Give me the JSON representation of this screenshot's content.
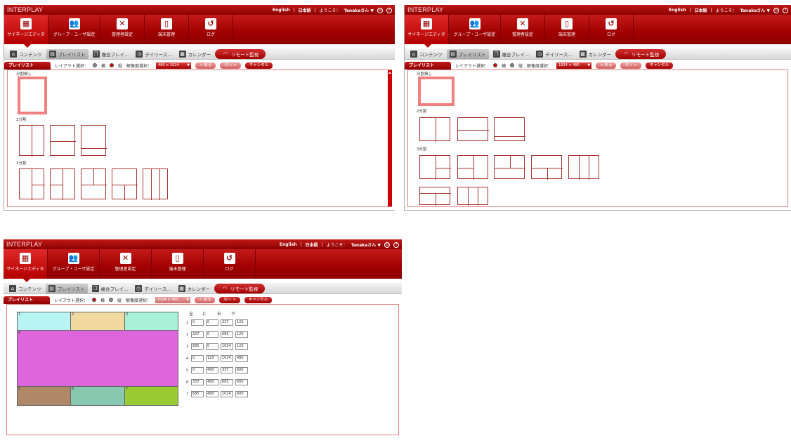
{
  "app": {
    "logo": "INTERPLAY",
    "lang_en": "English",
    "lang_ja": "日本語",
    "welcome": "ようこそ：",
    "user": "Tanakaさん ▼",
    "power_glyph": "⏻",
    "help_glyph": "?"
  },
  "nav": [
    {
      "label": "サイネージエディタ",
      "icon": "grid-pencil-icon",
      "glyph": "▦"
    },
    {
      "label": "グループ・ユーザ設定",
      "icon": "users-icon",
      "glyph": "👥"
    },
    {
      "label": "管理者設定",
      "icon": "tools-icon",
      "glyph": "✕"
    },
    {
      "label": "端末管理",
      "icon": "device-icon",
      "glyph": "▯"
    },
    {
      "label": "ログ",
      "icon": "log-icon",
      "glyph": "↺"
    }
  ],
  "subtabs": [
    {
      "label": "コンテンツ",
      "icon": "home-icon",
      "glyph": "⌂"
    },
    {
      "label": "プレイリスト",
      "icon": "playlist-icon",
      "glyph": "▤"
    },
    {
      "label": "複合プレイ...",
      "icon": "composite-icon",
      "glyph": "❐"
    },
    {
      "label": "デイリース...",
      "icon": "clock-icon",
      "glyph": "◷"
    },
    {
      "label": "カレンダー",
      "icon": "calendar-icon",
      "glyph": "▦"
    },
    {
      "label": "リモート監視",
      "icon": "wifi-icon",
      "glyph": "◠"
    }
  ],
  "toolbar": {
    "tab": "プレイリスト",
    "layout_label": "レイアウト選択：",
    "horizontal": "横",
    "vertical": "縦",
    "resolution_label": "解像度選択：",
    "back": "< 戻る",
    "next": "次へ >",
    "cancel": "キャンセル"
  },
  "panels": [
    {
      "resolution": "480 × 1024",
      "layout": "vertical"
    },
    {
      "resolution": "1024 × 480",
      "layout": "horizontal"
    },
    {
      "resolution": "1024 × 480",
      "layout": "horizontal"
    }
  ],
  "sections": {
    "none": "分割無し",
    "two": "2分割",
    "three": "3分割"
  },
  "coords": {
    "headers": [
      "左",
      "上",
      "右",
      "下"
    ],
    "rows": [
      {
        "n": "1",
        "v": [
          "0",
          "0",
          "337",
          "120"
        ]
      },
      {
        "n": "2",
        "v": [
          "337",
          "0",
          "685",
          "120"
        ]
      },
      {
        "n": "3",
        "v": [
          "685",
          "0",
          "1024",
          "120"
        ]
      },
      {
        "n": "4",
        "v": [
          "0",
          "120",
          "1024",
          "480"
        ]
      },
      {
        "n": "5",
        "v": [
          "0",
          "480",
          "337",
          "600"
        ]
      },
      {
        "n": "6",
        "v": [
          "337",
          "480",
          "685",
          "600"
        ]
      },
      {
        "n": "7",
        "v": [
          "685",
          "480",
          "1024",
          "600"
        ]
      }
    ]
  },
  "regions": [
    {
      "n": "1",
      "color": "#b8f4f4"
    },
    {
      "n": "2",
      "color": "#f2d9a0"
    },
    {
      "n": "3",
      "color": "#a8f0d8"
    },
    {
      "n": "4",
      "color": "#dd66dd"
    },
    {
      "n": "5",
      "color": "#b08868"
    },
    {
      "n": "6",
      "color": "#88c8b0"
    },
    {
      "n": "7",
      "color": "#99cc33"
    }
  ]
}
